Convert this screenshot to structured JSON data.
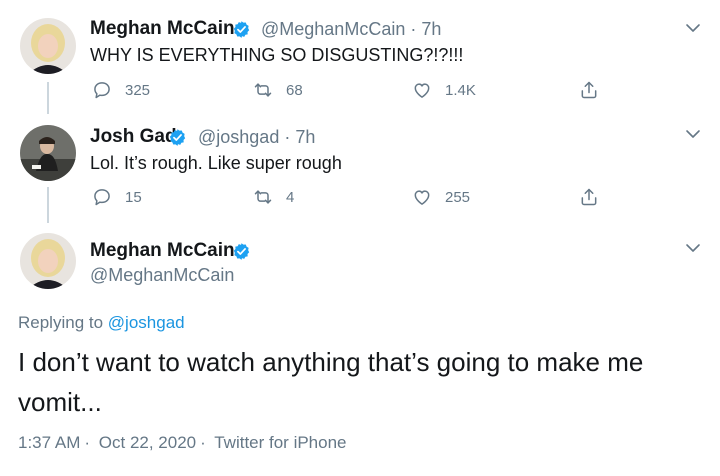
{
  "tweets": [
    {
      "name": "Meghan McCain",
      "handle": "@MeghanMcCain",
      "time": "7h",
      "text": "WHY IS EVERYTHING SO DISGUSTING?!?!!!",
      "replies": "325",
      "retweets": "68",
      "likes": "1.4K"
    },
    {
      "name": "Josh Gad",
      "handle": "@joshgad",
      "time": "7h",
      "text": "Lol. It’s rough. Like super rough",
      "replies": "15",
      "retweets": "4",
      "likes": "255"
    }
  ],
  "main_tweet": {
    "name": "Meghan McCain",
    "handle": "@MeghanMcCain",
    "replying_label": "Replying to",
    "replying_handle": "@joshgad",
    "text": "I don’t want to watch anything that’s going to make me vomit...",
    "time": "1:37 AM",
    "date": "Oct 22, 2020",
    "source": "Twitter for iPhone",
    "separator": "·"
  },
  "colors": {
    "accent": "#1da1f2",
    "link": "#1b95e0",
    "text": "#14171a",
    "muted": "#657786",
    "line": "#ccd6dd"
  },
  "icons": {
    "reply": "reply-icon",
    "retweet": "retweet-icon",
    "like": "heart-icon",
    "share": "share-icon",
    "verified": "verified-badge-icon",
    "menu": "chevron-down-icon"
  }
}
